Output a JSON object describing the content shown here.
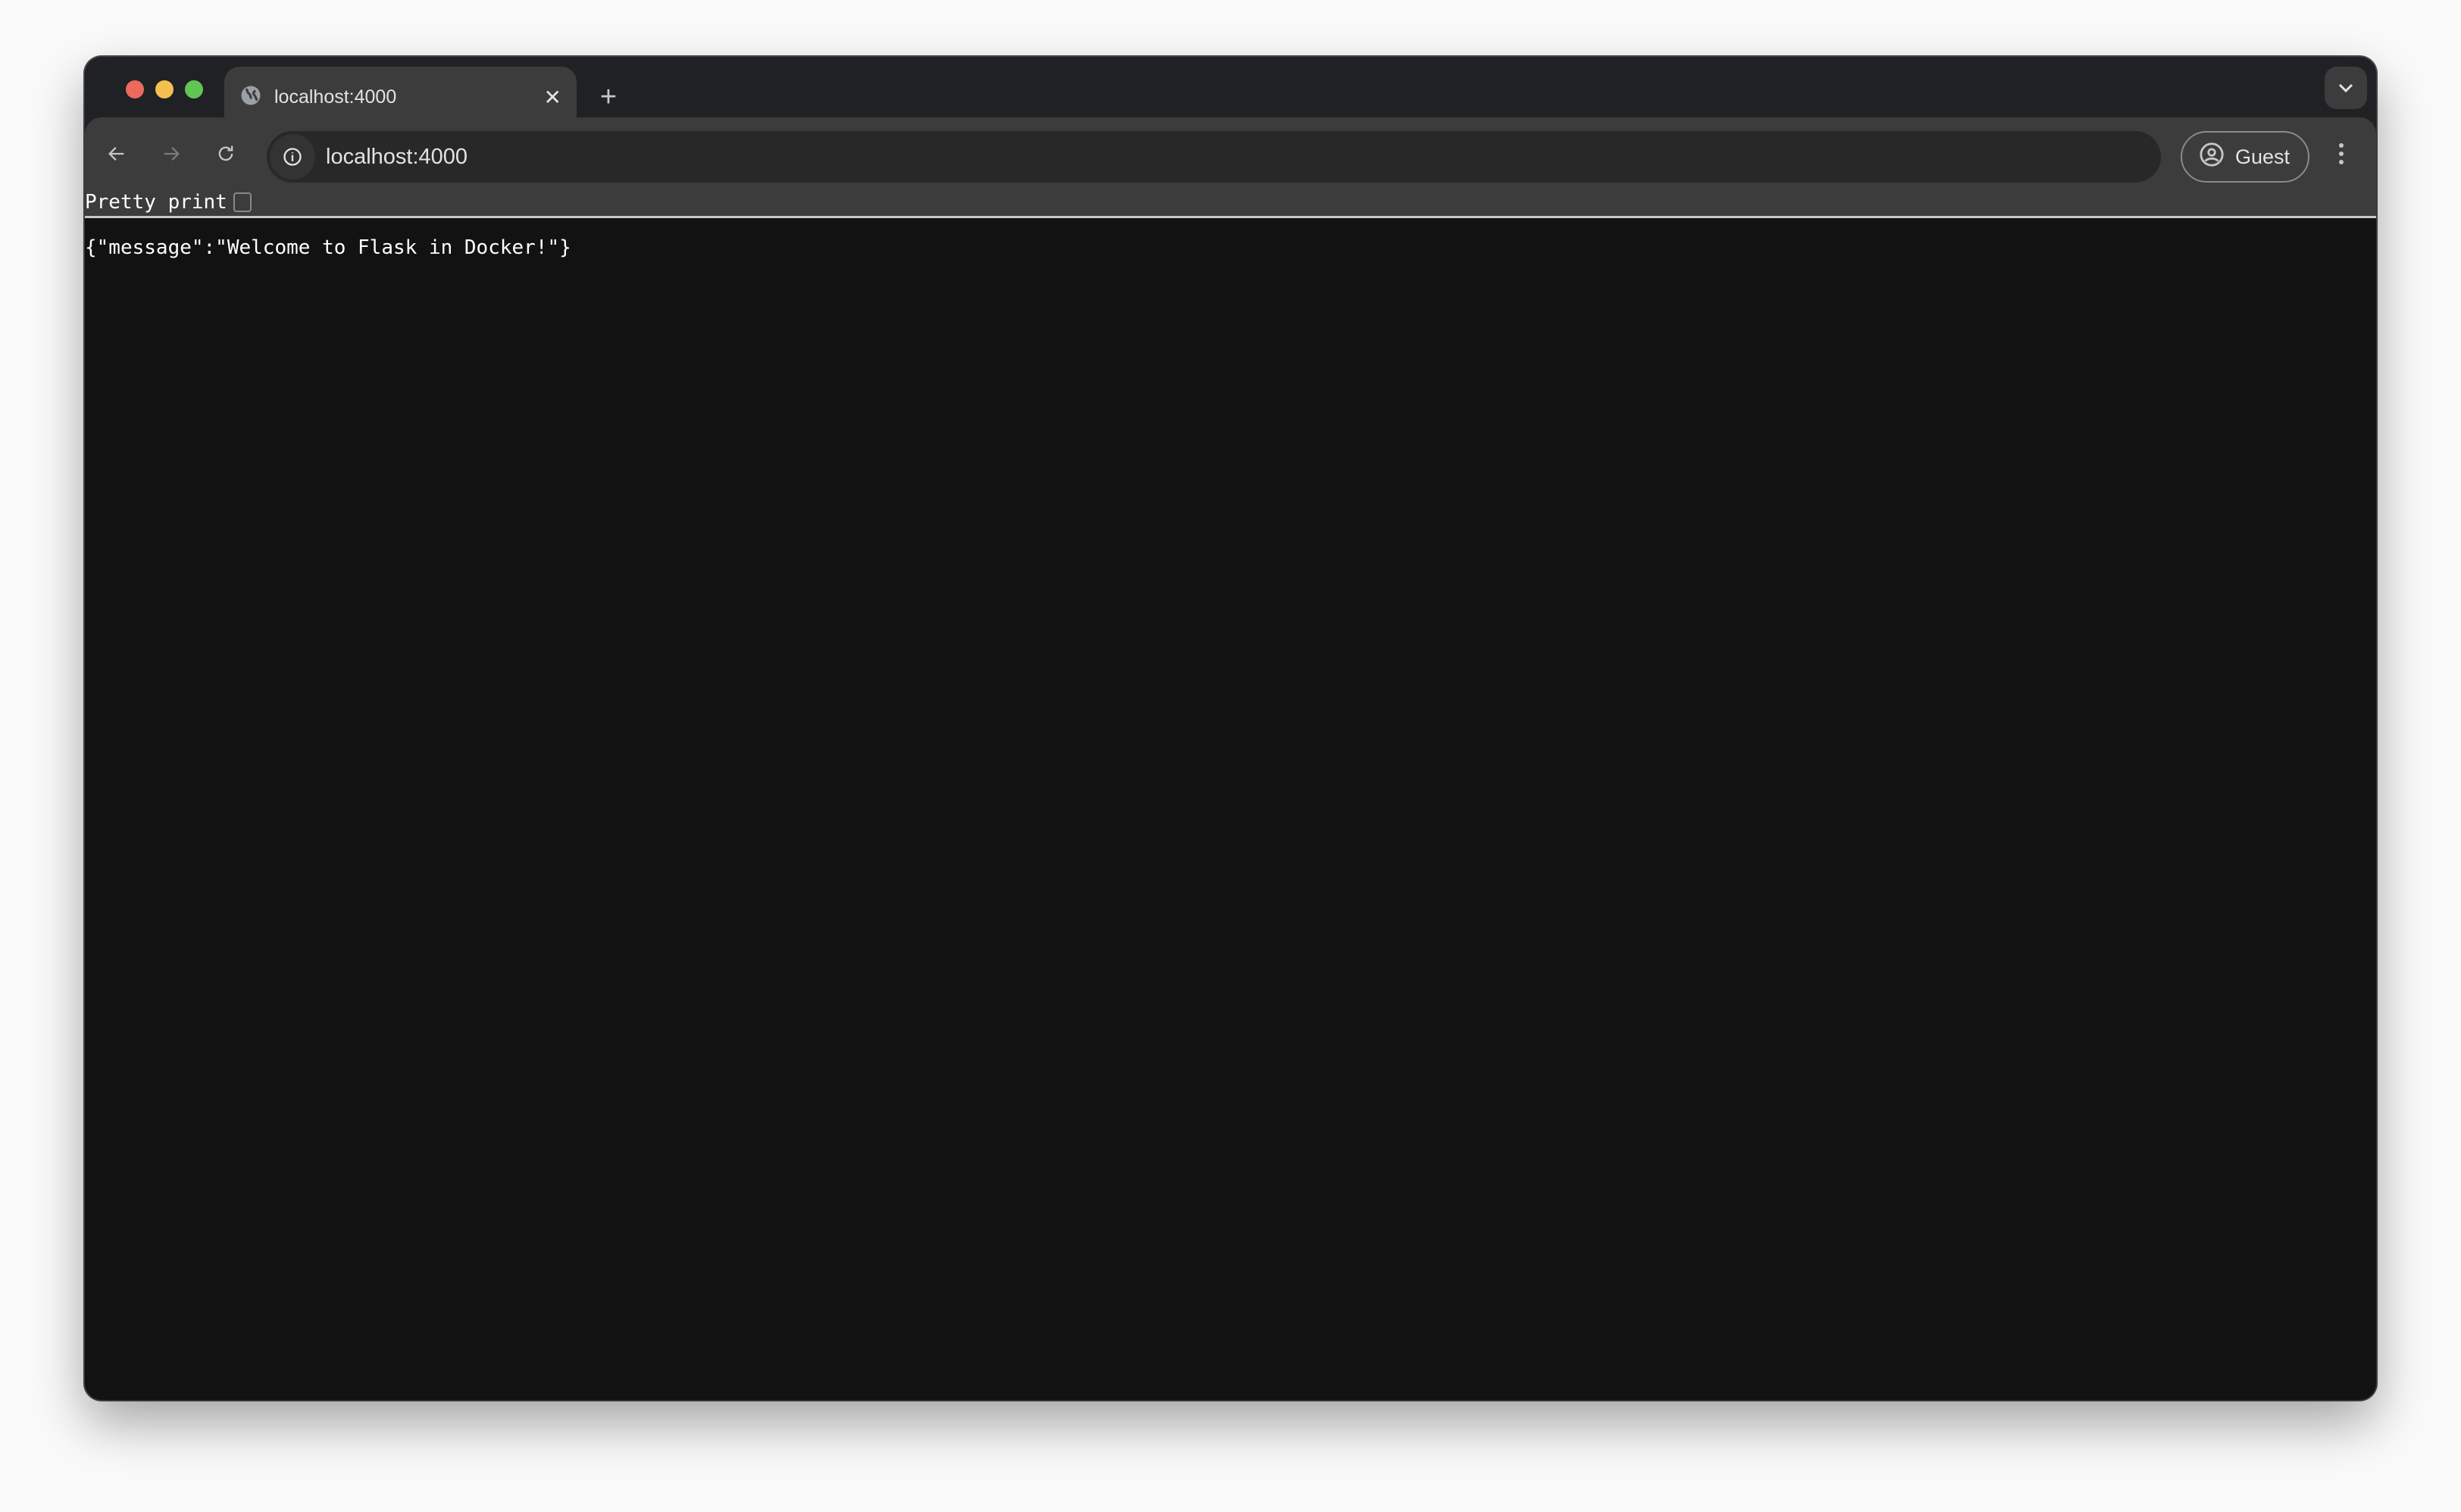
{
  "tab": {
    "title": "localhost:4000",
    "icon": "globe-icon"
  },
  "address_bar": {
    "url": "localhost:4000"
  },
  "profile": {
    "label": "Guest"
  },
  "json_viewer": {
    "pretty_print_label": "Pretty print",
    "pretty_print_checked": false,
    "body": "{\"message\":\"Welcome to Flask in Docker!\"}"
  },
  "colors": {
    "close": "#ed6a5e",
    "minimize": "#f5bf4f",
    "maximize": "#61c554"
  }
}
